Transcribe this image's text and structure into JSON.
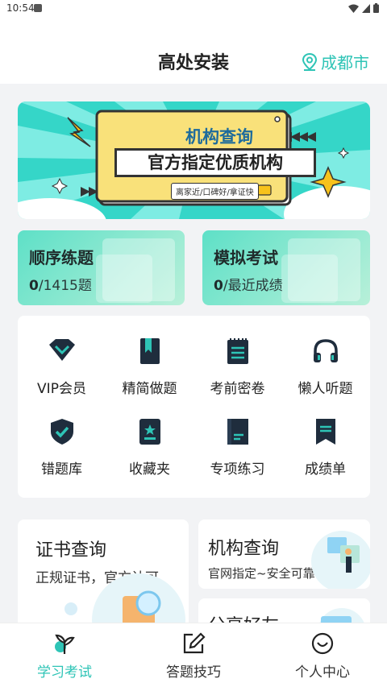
{
  "status_bar": {
    "time": "10:54"
  },
  "header": {
    "title": "高处安装",
    "city": "成都市"
  },
  "banner": {
    "title": "机构查询",
    "subtitle": "官方指定优质机构",
    "tags": "离家近/口碑好/拿证快"
  },
  "quick_cards": [
    {
      "title": "顺序练题",
      "count": "0",
      "rest": "/1415题"
    },
    {
      "title": "模拟考试",
      "count": "0",
      "rest": "/最近成绩"
    }
  ],
  "features": [
    {
      "label": "VIP会员",
      "icon": "vip-diamond-icon"
    },
    {
      "label": "精简做题",
      "icon": "bookmark-book-icon"
    },
    {
      "label": "考前密卷",
      "icon": "notepad-icon"
    },
    {
      "label": "懒人听题",
      "icon": "headphones-icon"
    },
    {
      "label": "错题库",
      "icon": "shield-check-icon"
    },
    {
      "label": "收藏夹",
      "icon": "favorite-folder-icon"
    },
    {
      "label": "专项练习",
      "icon": "document-icon"
    },
    {
      "label": "成绩单",
      "icon": "report-icon"
    }
  ],
  "cards": {
    "certificate": {
      "title": "证书查询",
      "subtitle": "正规证书，官方认可"
    },
    "institution": {
      "title": "机构查询",
      "subtitle": "官网指定~安全可靠"
    },
    "share": {
      "title": "分享好友"
    }
  },
  "tabs": [
    {
      "label": "学习考试",
      "icon": "sprout-icon"
    },
    {
      "label": "答题技巧",
      "icon": "edit-icon"
    },
    {
      "label": "个人中心",
      "icon": "smile-icon"
    }
  ],
  "colors": {
    "accent": "#2ec4b6",
    "dark": "#1f2d3d"
  }
}
